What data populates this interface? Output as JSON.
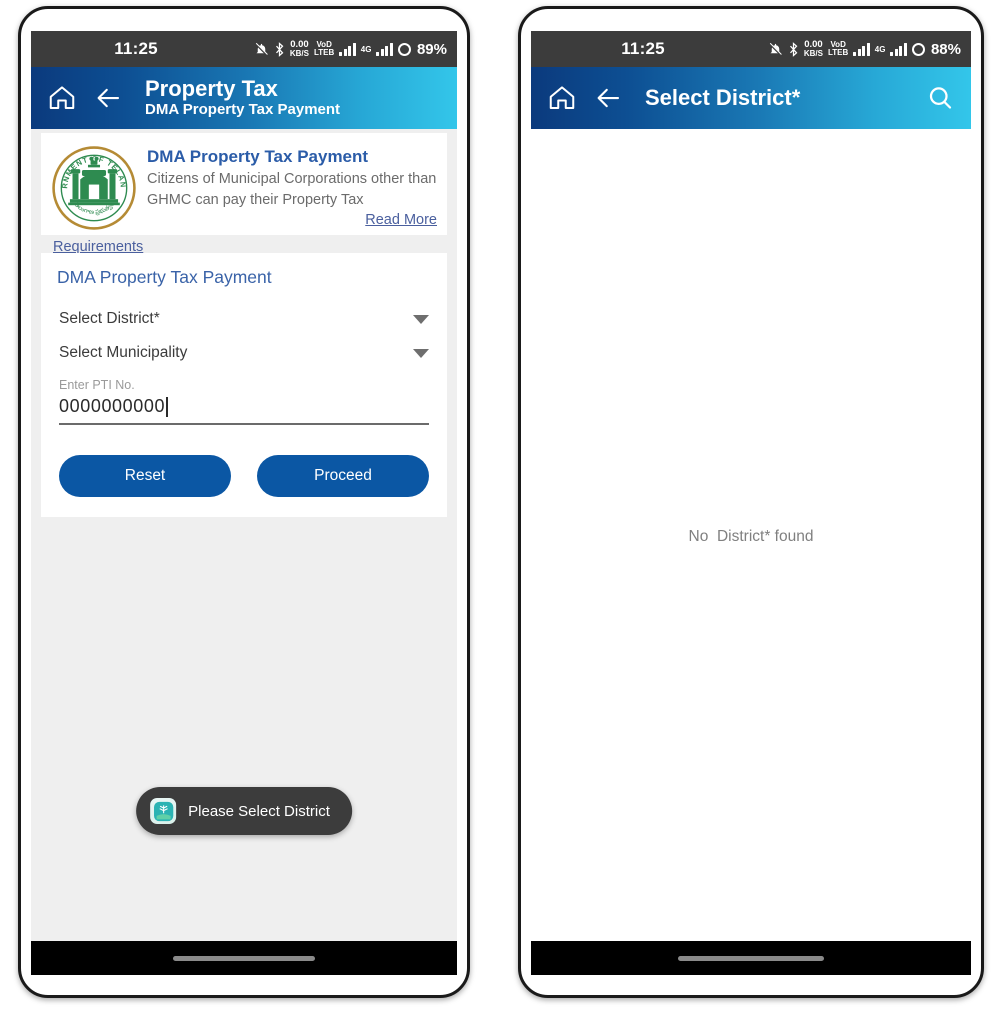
{
  "left_phone": {
    "status_bar": {
      "time": "11:25",
      "mute_icon": "bell-muted-icon",
      "bluetooth_icon": "bluetooth-icon",
      "data_rate": "0.00",
      "data_unit": "KB/S",
      "volte_line1": "VoD",
      "volte_line2": "LTEB",
      "network": "4G",
      "battery": "89%"
    },
    "app_bar": {
      "home_icon": "home-icon",
      "back_icon": "back-arrow-icon",
      "title": "Property Tax",
      "subtitle": "DMA Property Tax Payment"
    },
    "info_card": {
      "emblem_icon": "telangana-government-emblem",
      "title": "DMA Property Tax Payment",
      "description": "Citizens of Municipal Corporations other than GHMC can pay their Property Tax",
      "read_more": "Read More",
      "requirements": "Requirements"
    },
    "form": {
      "title": "DMA Property Tax Payment",
      "district_label": "Select District*",
      "municipality_label": "Select Municipality",
      "pti_hint": "Enter PTI No.",
      "pti_value": "0000000000",
      "reset_label": "Reset",
      "proceed_label": "Proceed"
    },
    "toast": {
      "icon": "app-icon",
      "message": "Please Select District"
    }
  },
  "right_phone": {
    "status_bar": {
      "time": "11:25",
      "mute_icon": "bell-muted-icon",
      "bluetooth_icon": "bluetooth-icon",
      "data_rate": "0.00",
      "data_unit": "KB/S",
      "volte_line1": "VoD",
      "volte_line2": "LTEB",
      "network": "4G",
      "battery": "88%"
    },
    "app_bar": {
      "home_icon": "home-icon",
      "back_icon": "back-arrow-icon",
      "title": "Select District*",
      "search_icon": "search-icon"
    },
    "empty_state": "No  District* found"
  },
  "colors": {
    "appbar_start": "#0b3a7d",
    "appbar_end": "#33c6ea",
    "button_blue": "#0b57a4",
    "link_blue": "#4a5f9e",
    "heading_blue": "#3a63a8",
    "page_bg": "#efefef",
    "toast_bg": "#3c3c3c"
  }
}
